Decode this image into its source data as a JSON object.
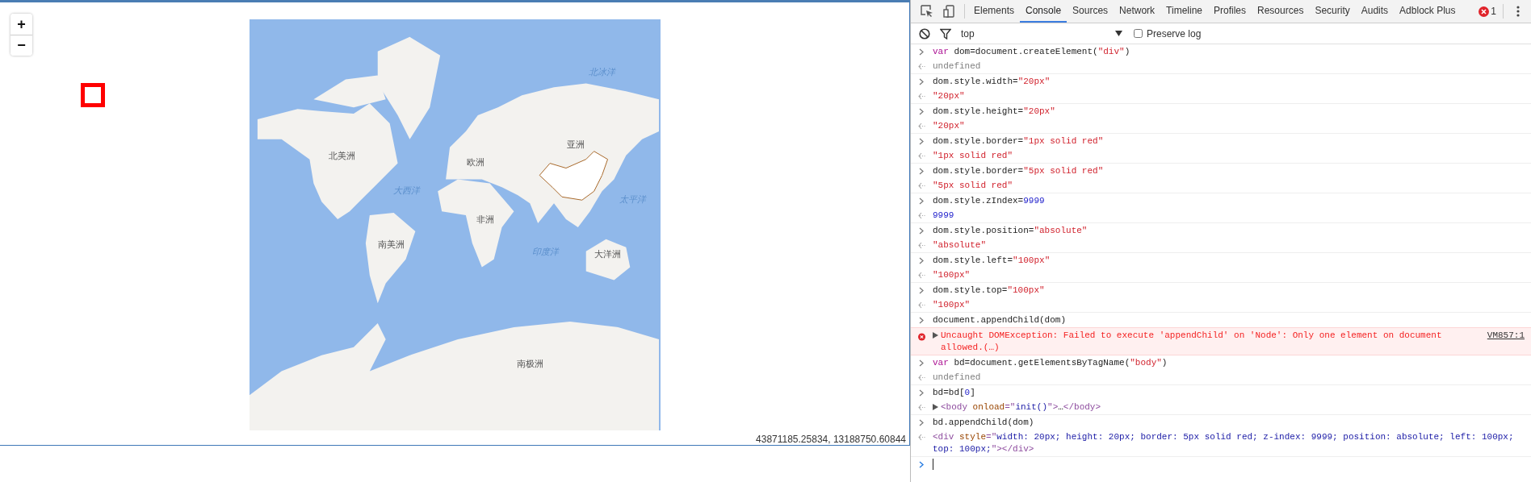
{
  "map": {
    "zoom_buttons": [
      "+",
      "−"
    ],
    "labels": [
      {
        "kind": "ocean",
        "text": "北冰洋"
      },
      {
        "kind": "continent",
        "text": "亚洲"
      },
      {
        "kind": "continent",
        "text": "北美洲"
      },
      {
        "kind": "continent",
        "text": "欧洲"
      },
      {
        "kind": "ocean",
        "text": "大西洋"
      },
      {
        "kind": "ocean",
        "text": "太平洋"
      },
      {
        "kind": "continent",
        "text": "非洲"
      },
      {
        "kind": "continent",
        "text": "南美洲"
      },
      {
        "kind": "ocean",
        "text": "印度洋"
      },
      {
        "kind": "continent",
        "text": "大洋洲"
      },
      {
        "kind": "continent",
        "text": "南极洲"
      }
    ],
    "coordinates": "43871185.25834, 13188750.60844"
  },
  "devtools": {
    "tabs": [
      {
        "label": "Elements",
        "selected": false
      },
      {
        "label": "Console",
        "selected": true
      },
      {
        "label": "Sources",
        "selected": false
      },
      {
        "label": "Network",
        "selected": false
      },
      {
        "label": "Timeline",
        "selected": false
      },
      {
        "label": "Profiles",
        "selected": false
      },
      {
        "label": "Resources",
        "selected": false
      },
      {
        "label": "Security",
        "selected": false
      },
      {
        "label": "Audits",
        "selected": false
      },
      {
        "label": "Adblock Plus",
        "selected": false
      }
    ],
    "error_count": "1",
    "context": "top",
    "preserve_log": {
      "label": "Preserve log",
      "checked": false
    },
    "console": [
      {
        "kind": "input",
        "tokens": [
          {
            "kind": "kw",
            "s": "var"
          },
          {
            "kind": "plain",
            "s": " dom=document.createElement("
          },
          {
            "kind": "str",
            "s": "\"div\""
          },
          {
            "kind": "plain",
            "s": ")"
          }
        ]
      },
      {
        "kind": "output",
        "tokens": [
          {
            "kind": "undef",
            "s": "undefined"
          }
        ]
      },
      {
        "kind": "input",
        "tokens": [
          {
            "kind": "plain",
            "s": "dom.style.width="
          },
          {
            "kind": "str",
            "s": "\"20px\""
          }
        ]
      },
      {
        "kind": "output",
        "tokens": [
          {
            "kind": "str",
            "s": "\"20px\""
          }
        ]
      },
      {
        "kind": "input",
        "tokens": [
          {
            "kind": "plain",
            "s": "dom.style.height="
          },
          {
            "kind": "str",
            "s": "\"20px\""
          }
        ]
      },
      {
        "kind": "output",
        "tokens": [
          {
            "kind": "str",
            "s": "\"20px\""
          }
        ]
      },
      {
        "kind": "input",
        "tokens": [
          {
            "kind": "plain",
            "s": "dom.style.border="
          },
          {
            "kind": "str",
            "s": "\"1px solid red\""
          }
        ]
      },
      {
        "kind": "output",
        "tokens": [
          {
            "kind": "str",
            "s": "\"1px solid red\""
          }
        ]
      },
      {
        "kind": "input",
        "tokens": [
          {
            "kind": "plain",
            "s": "dom.style.border="
          },
          {
            "kind": "str",
            "s": "\"5px solid red\""
          }
        ]
      },
      {
        "kind": "output",
        "tokens": [
          {
            "kind": "str",
            "s": "\"5px solid red\""
          }
        ]
      },
      {
        "kind": "input",
        "tokens": [
          {
            "kind": "plain",
            "s": "dom.style.zIndex="
          },
          {
            "kind": "num",
            "s": "9999"
          }
        ]
      },
      {
        "kind": "output",
        "tokens": [
          {
            "kind": "num",
            "s": "9999"
          }
        ]
      },
      {
        "kind": "input",
        "tokens": [
          {
            "kind": "plain",
            "s": "dom.style.position="
          },
          {
            "kind": "str",
            "s": "\"absolute\""
          }
        ]
      },
      {
        "kind": "output",
        "tokens": [
          {
            "kind": "str",
            "s": "\"absolute\""
          }
        ]
      },
      {
        "kind": "input",
        "tokens": [
          {
            "kind": "plain",
            "s": "dom.style.left="
          },
          {
            "kind": "str",
            "s": "\"100px\""
          }
        ]
      },
      {
        "kind": "output",
        "tokens": [
          {
            "kind": "str",
            "s": "\"100px\""
          }
        ]
      },
      {
        "kind": "input",
        "tokens": [
          {
            "kind": "plain",
            "s": "dom.style.top="
          },
          {
            "kind": "str",
            "s": "\"100px\""
          }
        ]
      },
      {
        "kind": "output",
        "tokens": [
          {
            "kind": "str",
            "s": "\"100px\""
          }
        ]
      },
      {
        "kind": "input",
        "tokens": [
          {
            "kind": "plain",
            "s": "document.appendChild(dom)"
          }
        ]
      },
      {
        "kind": "error",
        "message": "Uncaught DOMException: Failed to execute 'appendChild' on 'Node': Only one element on document allowed.(…)",
        "source": "VM857:1"
      },
      {
        "kind": "input",
        "tokens": [
          {
            "kind": "kw",
            "s": "var"
          },
          {
            "kind": "plain",
            "s": " bd=document.getElementsByTagName("
          },
          {
            "kind": "str",
            "s": "\"body\""
          },
          {
            "kind": "plain",
            "s": ")"
          }
        ]
      },
      {
        "kind": "output",
        "tokens": [
          {
            "kind": "undef",
            "s": "undefined"
          }
        ]
      },
      {
        "kind": "input",
        "tokens": [
          {
            "kind": "plain",
            "s": "bd=bd["
          },
          {
            "kind": "num",
            "s": "0"
          },
          {
            "kind": "plain",
            "s": "]"
          }
        ]
      },
      {
        "kind": "element",
        "tokens": [
          {
            "kind": "tag",
            "s": "<body "
          },
          {
            "kind": "attr",
            "s": "onload"
          },
          {
            "kind": "tag",
            "s": "=\""
          },
          {
            "kind": "val",
            "s": "init()"
          },
          {
            "kind": "tag",
            "s": "\">"
          },
          {
            "kind": "plain",
            "s": "…"
          },
          {
            "kind": "tag",
            "s": "</body>"
          }
        ]
      },
      {
        "kind": "input",
        "tokens": [
          {
            "kind": "plain",
            "s": "bd.appendChild(dom)"
          }
        ]
      },
      {
        "kind": "output",
        "tokens": [
          {
            "kind": "tag",
            "s": "<div "
          },
          {
            "kind": "attr",
            "s": "style"
          },
          {
            "kind": "tag",
            "s": "=\""
          },
          {
            "kind": "val",
            "s": "width: 20px; height: 20px; border: 5px solid red; z-index: 9999; position: absolute; left: 100px; top: 100px;"
          },
          {
            "kind": "tag",
            "s": "\"></div>"
          }
        ]
      }
    ]
  }
}
